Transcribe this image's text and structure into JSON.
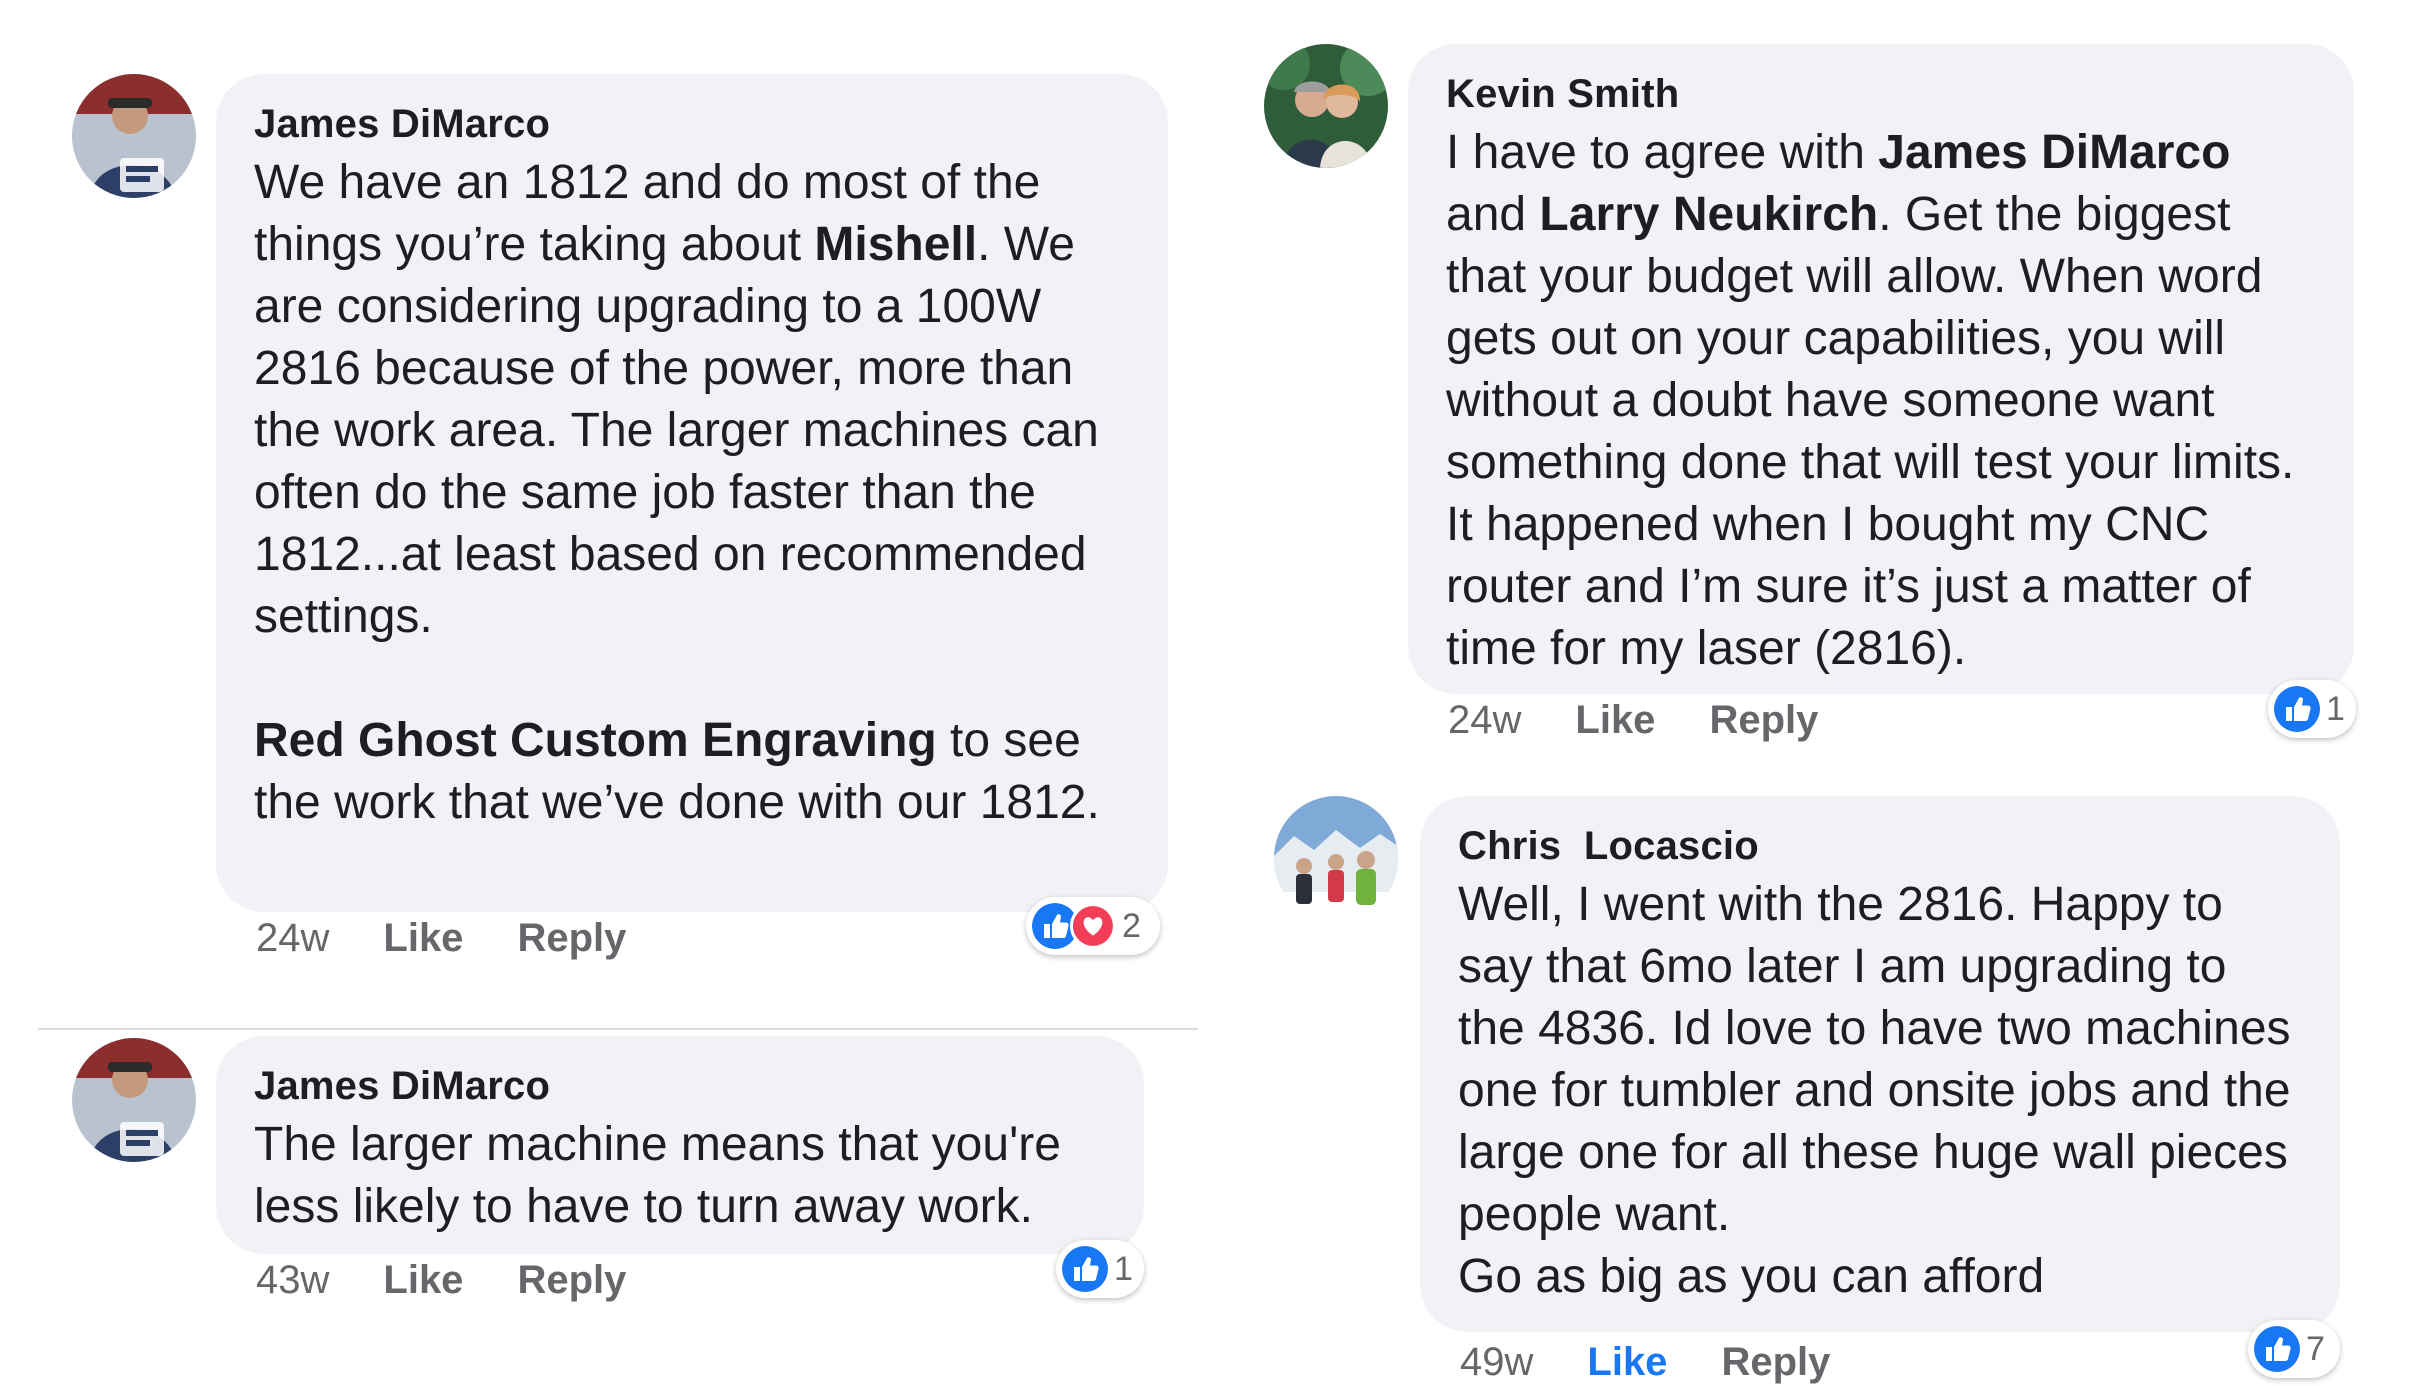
{
  "comments": [
    {
      "author": "James DiMarco",
      "paragraph1": {
        "pre": "We have an 1812 and do most of the things you’re taking about ",
        "mention": "Mishell",
        "post": ". We are considering upgrading to a 100W 2816 because of the power, more than the work area.  The larger machines can often do the same job faster than the 1812...at least based on recommended settings."
      },
      "paragraph2": {
        "mention": "Red Ghost Custom Engraving",
        "post": " to see the work that we’ve done with our 1812."
      },
      "time": "24w",
      "like_label": "Like",
      "reply_label": "Reply",
      "reaction_count": "2",
      "reactions": [
        "like-icon",
        "love-icon"
      ]
    },
    {
      "author": "James DiMarco",
      "text": "The larger machine means that you're less likely to have to turn away work.",
      "time": "43w",
      "like_label": "Like",
      "reply_label": "Reply",
      "reaction_count": "1",
      "reactions": [
        "like-icon"
      ]
    },
    {
      "author": "Kevin Smith",
      "text_pre": "I have to agree with ",
      "mention1": "James DiMarco",
      "text_mid": " and ",
      "mention2": "Larry Neukirch",
      "text_post": ". Get the biggest that your budget will allow. When word gets out on your capabilities, you will without a doubt have someone want something done that will test your limits. It happened when I bought my CNC router and I’m sure it’s just a matter of time for my laser (2816).",
      "time": "24w",
      "like_label": "Like",
      "reply_label": "Reply",
      "reaction_count": "1",
      "reactions": [
        "like-icon"
      ]
    },
    {
      "author": "Chris  Locascio",
      "line_main": "Well, I went with the 2816. Happy to say that 6mo later I am upgrading to the 4836. Id love to have two machines one for tumbler and onsite jobs and the large one for all these huge wall pieces people want.",
      "line_last": "Go as big as you can afford",
      "time": "49w",
      "like_label": "Like",
      "reply_label": "Reply",
      "reaction_count": "7",
      "reactions": [
        "like-icon"
      ],
      "liked": true
    }
  ],
  "colors": {
    "bubble": "#f0f2f5",
    "like_blue": "#1877f2",
    "love_red": "#f33e58",
    "meta_gray": "#65676b"
  }
}
